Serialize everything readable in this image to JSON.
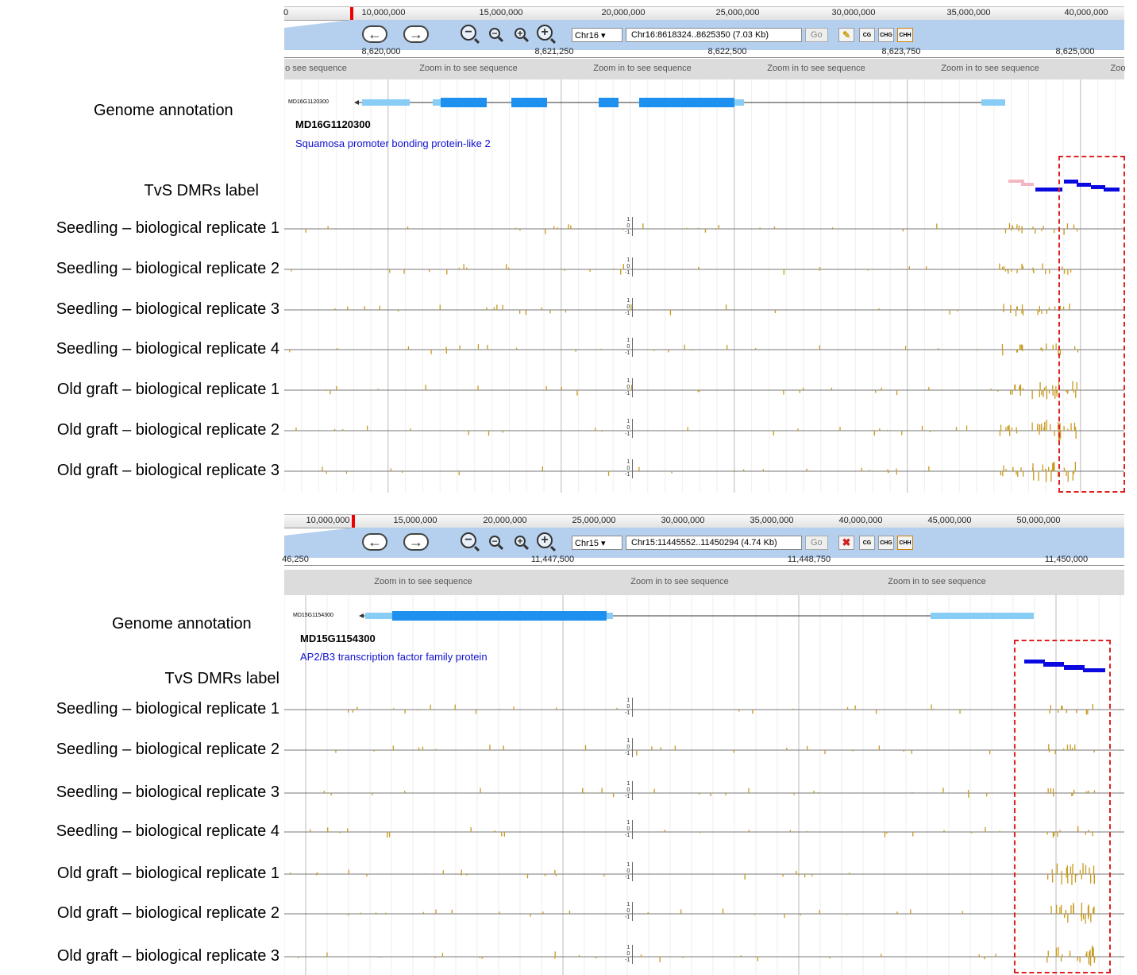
{
  "panel_top": {
    "ruler_labels": [
      "0",
      "10,000,000",
      "15,000,000",
      "20,000,000",
      "25,000,000",
      "30,000,000",
      "35,000,000",
      "40,000,000"
    ],
    "chrom_select": "Chr16",
    "location": "Chr16:8618324..8625350 (7.03 Kb)",
    "go_label": "Go",
    "buttons": [
      "CG",
      "CHG",
      "CHH"
    ],
    "scale_labels": [
      "8,620,000",
      "8,621,250",
      "8,622,500",
      "8,623,750",
      "8,625,000"
    ],
    "seq_text": "Zoom in to see sequence",
    "gene_id": "MD16G1120300",
    "gene_name": "MD16G1120300",
    "gene_desc": "Squamosa promoter bonding protein-like 2",
    "labels": {
      "annotation": "Genome annotation",
      "dmr": "TvS DMRs label",
      "tracks": [
        "Seedling – biological replicate 1",
        "Seedling – biological replicate 2",
        "Seedling – biological replicate 3",
        "Seedling – biological replicate 4",
        "Old graft – biological replicate 1",
        "Old graft – biological replicate 2",
        "Old graft – biological replicate 3"
      ]
    }
  },
  "panel_bottom": {
    "ruler_labels": [
      "10,000,000",
      "15,000,000",
      "20,000,000",
      "25,000,000",
      "30,000,000",
      "35,000,000",
      "40,000,000",
      "45,000,000",
      "50,000,000"
    ],
    "chrom_select": "Chr15",
    "location": "Chr15:11445552..11450294 (4.74 Kb)",
    "go_label": "Go",
    "buttons": [
      "CG",
      "CHG",
      "CHH"
    ],
    "scale_labels": [
      "46,250",
      "11,447,500",
      "11,448,750",
      "11,450,000"
    ],
    "seq_text": "Zoom in to see sequence",
    "gene_id": "MD15G1154300",
    "gene_name": "MD15G1154300",
    "gene_desc": "AP2/B3 transcription factor family protein",
    "labels": {
      "annotation": "Genome annotation",
      "dmr": "TvS DMRs label",
      "tracks": [
        "Seedling – biological replicate 1",
        "Seedling – biological replicate 2",
        "Seedling – biological replicate 3",
        "Seedling – biological replicate 4",
        "Old graft – biological replicate 1",
        "Old graft – biological replicate 2",
        "Old graft – biological replicate 3"
      ]
    }
  },
  "axis_ticks": [
    "1",
    "0",
    "-1"
  ],
  "colors": {
    "methylation_bar": "#c99a1e",
    "dmr_hyper": "#0a0ae0",
    "dmr_hypo": "#f4b6c2",
    "exon": "#1e90f0",
    "utr": "#87cdf5",
    "dash_box": "#e02020"
  }
}
